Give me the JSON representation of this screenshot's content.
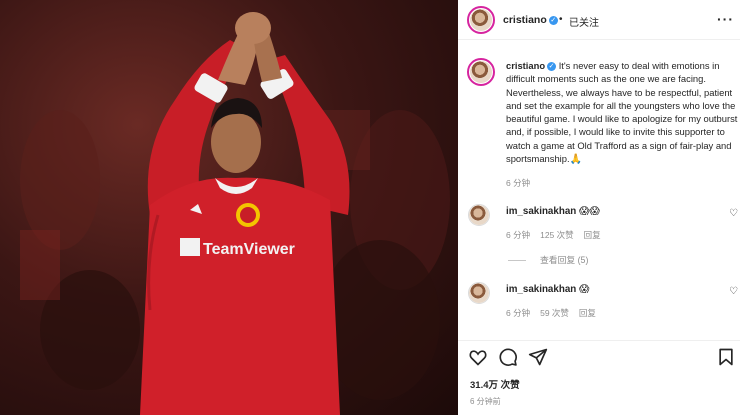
{
  "post": {
    "username": "cristiano",
    "verified": true,
    "separator": "•",
    "follow_label": "已关注",
    "more_label": "···"
  },
  "caption": {
    "username": "cristiano",
    "text": "It's never easy to deal with emotions in difficult moments such as the one we are facing. Nevertheless, we always have to be respectful, patient and set the example for all the youngsters who love the beautiful game. I would like to apologize for my outburst and, if possible, I would like to invite this supporter to watch a game at Old Trafford as a sign of fair-play and sportsmanship.",
    "emoji": "🙏",
    "time": "6 分钟"
  },
  "comments": [
    {
      "username": "im_sakinakhan",
      "emoji": "😱😱",
      "time": "6 分钟",
      "likes": "125 次赞",
      "reply_label": "回复"
    },
    {
      "username": "im_sakinakhan",
      "emoji": "😱",
      "time": "6 分钟",
      "likes": "59 次赞",
      "reply_label": "回复"
    }
  ],
  "view_replies": "查看回复 (5)",
  "stats": {
    "likes": "31.4万 次赞",
    "posted_ago": "6 分钟前"
  },
  "photo": {
    "jersey_text": "TeamViewer"
  },
  "colors": {
    "accent_blue": "#3897f0",
    "muted_text": "#8e8e8e",
    "jersey_red": "#d0202a"
  }
}
